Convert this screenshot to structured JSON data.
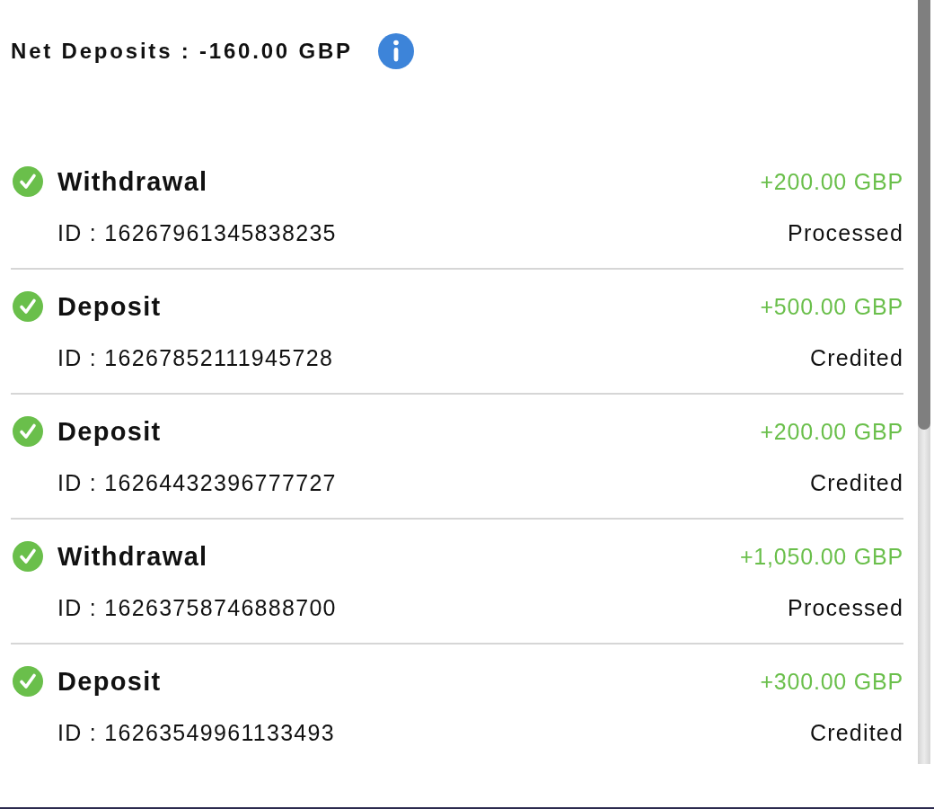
{
  "summary": {
    "label": "Net Deposits : -160.00 GBP"
  },
  "transactions": [
    {
      "type": "Withdrawal",
      "id": "ID : 16267961345838235",
      "amount": "+200.00 GBP",
      "status": "Processed"
    },
    {
      "type": "Deposit",
      "id": "ID : 16267852111945728",
      "amount": "+500.00 GBP",
      "status": "Credited"
    },
    {
      "type": "Deposit",
      "id": "ID : 16264432396777727",
      "amount": "+200.00 GBP",
      "status": "Credited"
    },
    {
      "type": "Withdrawal",
      "id": "ID : 16263758746888700",
      "amount": "+1,050.00 GBP",
      "status": "Processed"
    },
    {
      "type": "Deposit",
      "id": "ID : 16263549961133493",
      "amount": "+300.00 GBP",
      "status": "Credited"
    }
  ]
}
